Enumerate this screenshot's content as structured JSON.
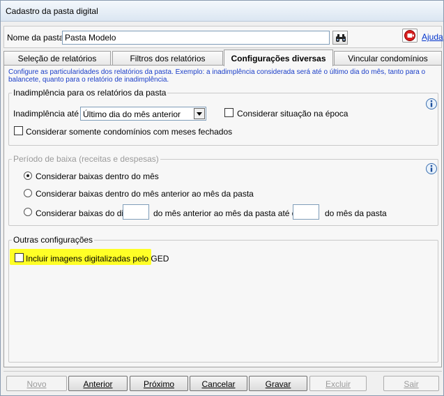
{
  "window": {
    "title": "Cadastro da pasta digital"
  },
  "header": {
    "name_label": "Nome da pasta:",
    "name_value": "Pasta Modelo",
    "help_link": "Ajuda"
  },
  "tabs": [
    {
      "label": "Seleção de relatórios",
      "active": false
    },
    {
      "label": "Filtros dos relatórios",
      "active": false
    },
    {
      "label": "Configurações diversas",
      "active": true
    },
    {
      "label": "Vincular condomínios",
      "active": false
    }
  ],
  "description": "Configure as particularidades dos relatórios da pasta. Exemplo: a inadimplência considerada será até o último dia do mês, tanto para o balancete, quanto para o relatório de inadimplência.",
  "inadimplencia": {
    "legend": "Inadimplência para os relatórios da pasta",
    "ate_label": "Inadimplência até",
    "ate_value": "Último dia do mês anterior",
    "situacao_label": "Considerar situação na época",
    "situacao_checked": false,
    "meses_fechados_label": "Considerar somente condomínios com meses fechados",
    "meses_fechados_checked": false
  },
  "periodo": {
    "legend": "Período de baixa (receitas e despesas)",
    "options": [
      {
        "label": "Considerar baixas dentro do mês",
        "selected": true
      },
      {
        "label": "Considerar baixas dentro do mês anterior ao mês da pasta",
        "selected": false
      },
      {
        "label": "Considerar baixas do dia",
        "selected": false
      }
    ],
    "from_day": "",
    "middle_text": "do mês anterior ao mês da pasta até dia",
    "to_day": "",
    "end_text": "do mês da pasta"
  },
  "outras": {
    "legend": "Outras configurações",
    "ged_label": "Incluir imagens digitalizadas pelo GED",
    "ged_checked": false
  },
  "buttons": [
    {
      "label": "Novo",
      "enabled": false
    },
    {
      "label": "Anterior",
      "enabled": true
    },
    {
      "label": "Próximo",
      "enabled": true
    },
    {
      "label": "Cancelar",
      "enabled": true
    },
    {
      "label": "Gravar",
      "enabled": true
    },
    {
      "label": "Excluir",
      "enabled": false
    },
    {
      "label": "Sair",
      "enabled": false
    }
  ],
  "colors": {
    "highlight": "#ffff26",
    "description_text": "#1a3ec8",
    "help_link": "#0033cc"
  }
}
